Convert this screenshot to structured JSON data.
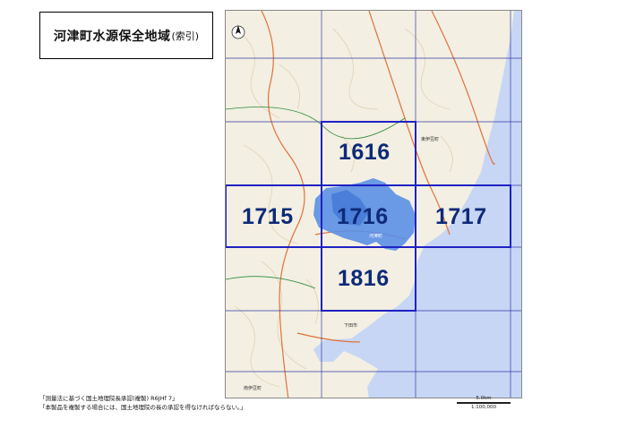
{
  "title": {
    "main": "河津町水源保全地域",
    "sub": "(索引)"
  },
  "grid_cells": [
    {
      "id": "1616",
      "label": "1616"
    },
    {
      "id": "1715",
      "label": "1715"
    },
    {
      "id": "1716",
      "label": "1716"
    },
    {
      "id": "1717",
      "label": "1717"
    },
    {
      "id": "1816",
      "label": "1816"
    }
  ],
  "map_labels": {
    "east_izu": "東伊豆町",
    "kawazu": "河津町",
    "shimoda": "下田市",
    "minami_izu": "南伊豆町"
  },
  "copyright": {
    "line1": "「測量法に基づく国土地理院長承認(複製) R6JHf 7」",
    "line2": "「本製品を複製する場合には、国土地理院の長の承認を得なければならない。」"
  },
  "scale": {
    "distance": "5.0km",
    "ratio": "1:100,000"
  },
  "colors": {
    "sea": "#c7d6f4",
    "land": "#f3efe2",
    "protection_area": "#5b8fe6",
    "highlight_border": "#1e22c4",
    "grid_line": "#2f3aa8",
    "label": "#0d2a78"
  },
  "north_arrow": "north-arrow-icon"
}
